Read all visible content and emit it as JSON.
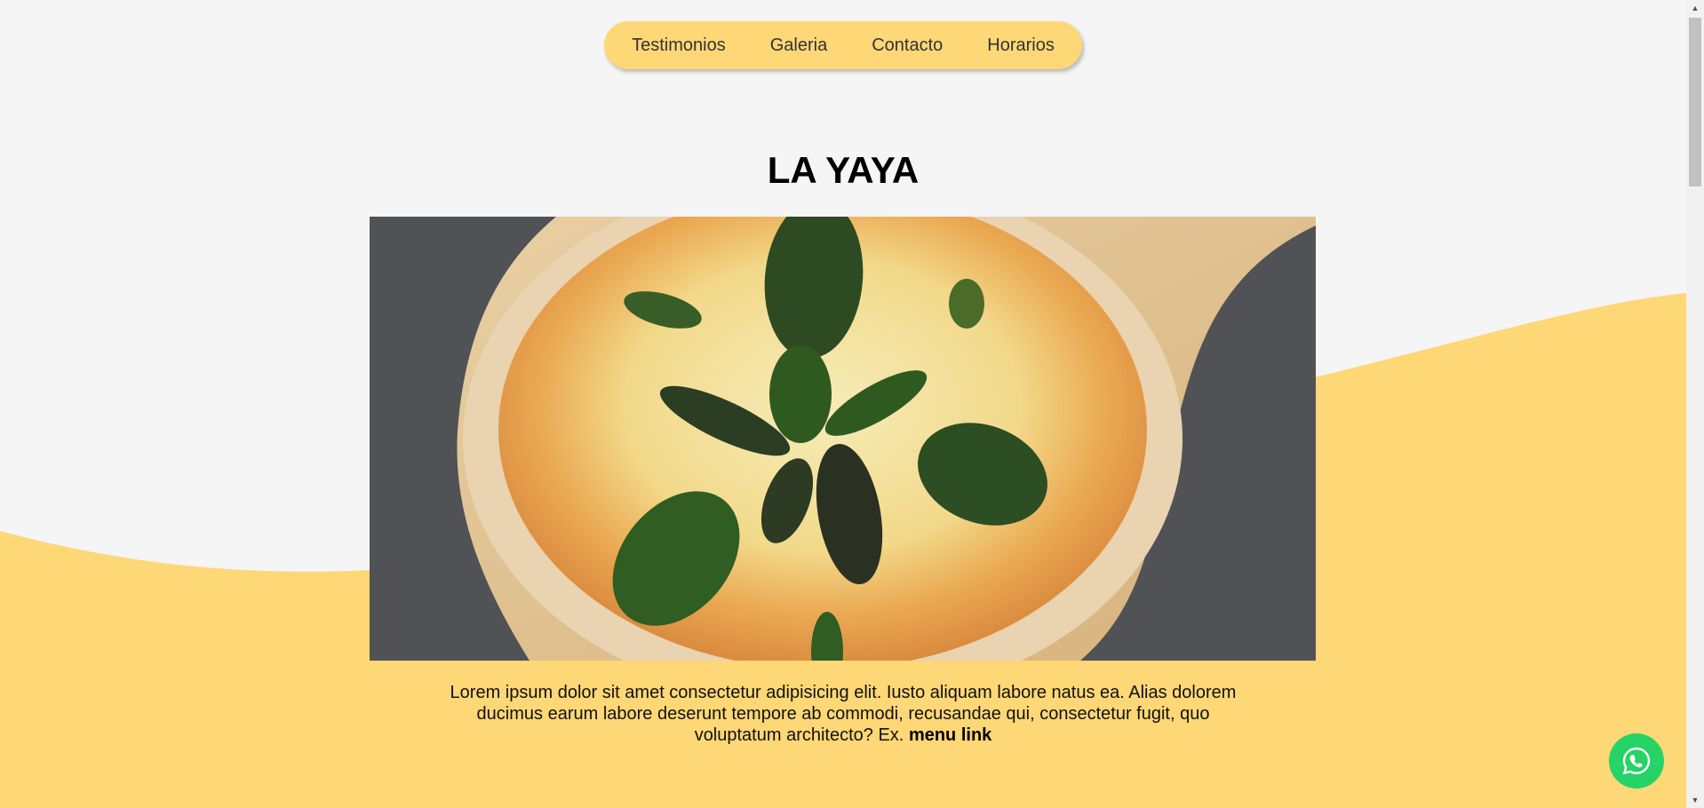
{
  "nav": {
    "items": [
      {
        "label": "Testimonios"
      },
      {
        "label": "Galeria"
      },
      {
        "label": "Contacto"
      },
      {
        "label": "Horarios"
      }
    ]
  },
  "hero": {
    "title": "LA YAYA"
  },
  "description": {
    "text": "Lorem ipsum dolor sit amet consectetur adipisicing elit. Iusto aliquam labore natus ea. Alias dolorem ducimus earum labore deserunt tempore ab commodi, recusandae qui, consectetur fugit, quo voluptatum architecto? Ex.",
    "link_label": "menu link"
  },
  "colors": {
    "accent": "#fed776",
    "background": "#f5f5f5",
    "whatsapp": "#25d366"
  },
  "icons": {
    "whatsapp": "whatsapp-icon"
  }
}
